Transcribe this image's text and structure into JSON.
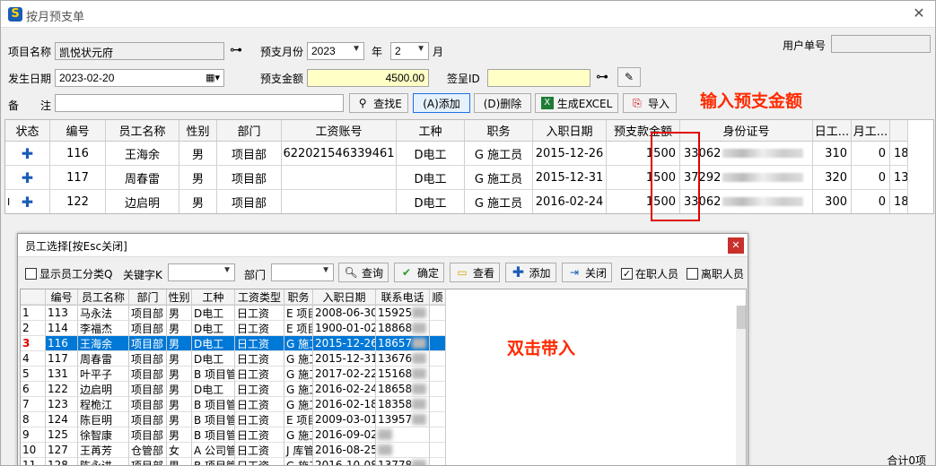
{
  "window": {
    "title": "按月预支单"
  },
  "form": {
    "project_label": "项目名称",
    "project_value": "凯悦状元府",
    "month_label": "预支月份",
    "year_value": "2023",
    "year_unit": "年",
    "month_value": "2",
    "month_unit": "月",
    "user_no_label": "用户单号",
    "user_no_value": "",
    "date_label": "发生日期",
    "date_value": "2023-02-20",
    "amount_label": "预支金额",
    "amount_value": "4500.00",
    "sign_label": "签呈ID",
    "sign_value": "",
    "remark_label_1": "备",
    "remark_label_2": "注",
    "remark_value": ""
  },
  "toolbar": {
    "find": "查找E",
    "add": "(A)添加",
    "delete": "(D)删除",
    "excel": "生成EXCEL",
    "import": "导入"
  },
  "annotations": {
    "amount_note": "输入预支金额",
    "dblclick_note": "双击带入"
  },
  "main_grid": {
    "headers": [
      "状态",
      "编号",
      "员工名称",
      "性别",
      "部门",
      "工资账号",
      "工种",
      "职务",
      "入职日期",
      "预支款金额",
      "身份证号",
      "日工...",
      "月工...",
      ""
    ],
    "rows": [
      {
        "no": "116",
        "name": "王海余",
        "sex": "男",
        "dept": "项目部",
        "account": "622021546339461",
        "type": "D电工",
        "job": "G 施工员",
        "date": "2015-12-26",
        "amount": "1500",
        "id": "33062",
        "day": "310",
        "month": "0",
        "extra": "18"
      },
      {
        "no": "117",
        "name": "周春雷",
        "sex": "男",
        "dept": "项目部",
        "account": "",
        "type": "D电工",
        "job": "G 施工员",
        "date": "2015-12-31",
        "amount": "1500",
        "id": "37292",
        "day": "320",
        "month": "0",
        "extra": "13"
      },
      {
        "no": "122",
        "name": "边启明",
        "sex": "男",
        "dept": "项目部",
        "account": "",
        "type": "D电工",
        "job": "G 施工员",
        "date": "2016-02-24",
        "amount": "1500",
        "id": "33062",
        "day": "300",
        "month": "0",
        "extra": "18"
      }
    ],
    "row_cursor": "I"
  },
  "popup": {
    "title": "员工选择[按Esc关闭]",
    "show_class": "显示员工分类Q",
    "keyword_label": "关键字K",
    "dept_label": "部门",
    "query": "查询",
    "ok": "确定",
    "view": "查看",
    "add": "添加",
    "close": "关闭",
    "active_label": "在职人员",
    "left_label": "离职人员",
    "headers": [
      "",
      "编号",
      "员工名称",
      "部门",
      "性别",
      "工种",
      "工资类型",
      "职务",
      "入职日期",
      "联系电话",
      "顺"
    ],
    "rows": [
      {
        "n": "1",
        "no": "113",
        "name": "马永法",
        "dept": "项目部",
        "sex": "男",
        "type": "D电工",
        "wage": "日工资",
        "job": "E 项目",
        "date": "2008-06-30",
        "tel": "15925"
      },
      {
        "n": "2",
        "no": "114",
        "name": "李福杰",
        "dept": "项目部",
        "sex": "男",
        "type": "D电工",
        "wage": "日工资",
        "job": "E 项目",
        "date": "1900-01-02",
        "tel": "18868"
      },
      {
        "n": "3",
        "no": "116",
        "name": "王海余",
        "dept": "项目部",
        "sex": "男",
        "type": "D电工",
        "wage": "日工资",
        "job": "G 施工",
        "date": "2015-12-26",
        "tel": "18657"
      },
      {
        "n": "4",
        "no": "117",
        "name": "周春雷",
        "dept": "项目部",
        "sex": "男",
        "type": "D电工",
        "wage": "日工资",
        "job": "G 施工",
        "date": "2015-12-31",
        "tel": "13676"
      },
      {
        "n": "5",
        "no": "131",
        "name": "叶平子",
        "dept": "项目部",
        "sex": "男",
        "type": "B 项目管",
        "wage": "日工资",
        "job": "G 施工",
        "date": "2017-02-22",
        "tel": "15168"
      },
      {
        "n": "6",
        "no": "122",
        "name": "边启明",
        "dept": "项目部",
        "sex": "男",
        "type": "D电工",
        "wage": "日工资",
        "job": "G 施工",
        "date": "2016-02-24",
        "tel": "18658"
      },
      {
        "n": "7",
        "no": "123",
        "name": "程桅江",
        "dept": "项目部",
        "sex": "男",
        "type": "B 项目管",
        "wage": "日工资",
        "job": "G 施工",
        "date": "2016-02-18",
        "tel": "18358"
      },
      {
        "n": "8",
        "no": "124",
        "name": "陈巨明",
        "dept": "项目部",
        "sex": "男",
        "type": "B 项目管",
        "wage": "日工资",
        "job": "E 项目",
        "date": "2009-03-01",
        "tel": "13957"
      },
      {
        "n": "9",
        "no": "125",
        "name": "徐智康",
        "dept": "项目部",
        "sex": "男",
        "type": "B 项目管",
        "wage": "日工资",
        "job": "G 施工",
        "date": "2016-09-02",
        "tel": ""
      },
      {
        "n": "10",
        "no": "127",
        "name": "王苒芳",
        "dept": "仓管部",
        "sex": "女",
        "type": "A 公司管",
        "wage": "日工资",
        "job": "J 库管",
        "date": "2016-08-25",
        "tel": ""
      },
      {
        "n": "11",
        "no": "128",
        "name": "陈永进",
        "dept": "项目部",
        "sex": "男",
        "type": "B 项目管",
        "wage": "日工资",
        "job": "G 施工",
        "date": "2016-10-08",
        "tel": "13778"
      }
    ],
    "selected_index": 2
  },
  "status": {
    "total": "合计0项"
  }
}
